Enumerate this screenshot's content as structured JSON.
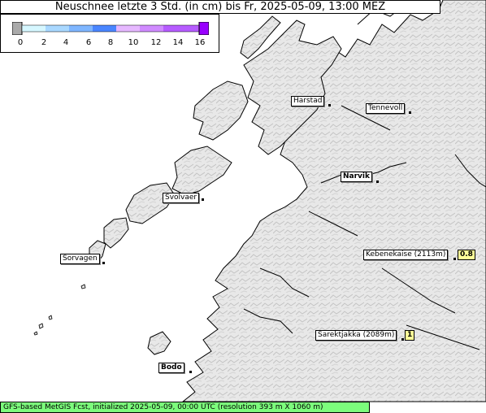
{
  "title": "Neuschnee letzte 3 Std. (in cm) bis Fr, 2025-05-09, 13:00 MEZ",
  "legend": {
    "ticks": [
      "0",
      "2",
      "4",
      "6",
      "8",
      "10",
      "12",
      "14",
      "16"
    ],
    "colors": [
      "#aaaaaa",
      "#d6f7ff",
      "#a9d8ff",
      "#7fb6ff",
      "#4a86ff",
      "#e6b8ff",
      "#d08bff",
      "#b65cff",
      "#9900ff"
    ]
  },
  "places": [
    {
      "name": "Harstad",
      "bold": false
    },
    {
      "name": "Tennevoll",
      "bold": false
    },
    {
      "name": "Narvik",
      "bold": true
    },
    {
      "name": "Svolvaer",
      "bold": false
    },
    {
      "name": "Sorvagen",
      "bold": false
    },
    {
      "name": "Kebenekaise (2113m)",
      "bold": false,
      "value": "0.8"
    },
    {
      "name": "Sarektjakka (2089m)",
      "bold": false,
      "value": "1"
    },
    {
      "name": "Bodo",
      "bold": true
    }
  ],
  "footer": "GFS-based MetGIS Fcst, initialized 2025-05-09, 00:00 UTC  (resolution 393 m X 1060 m)",
  "colors": {
    "land": "#e6e6e6",
    "water": "#ffffff",
    "coast": "#000000",
    "value_box": "#ffff99",
    "footer_bg": "#7cfc7c"
  }
}
